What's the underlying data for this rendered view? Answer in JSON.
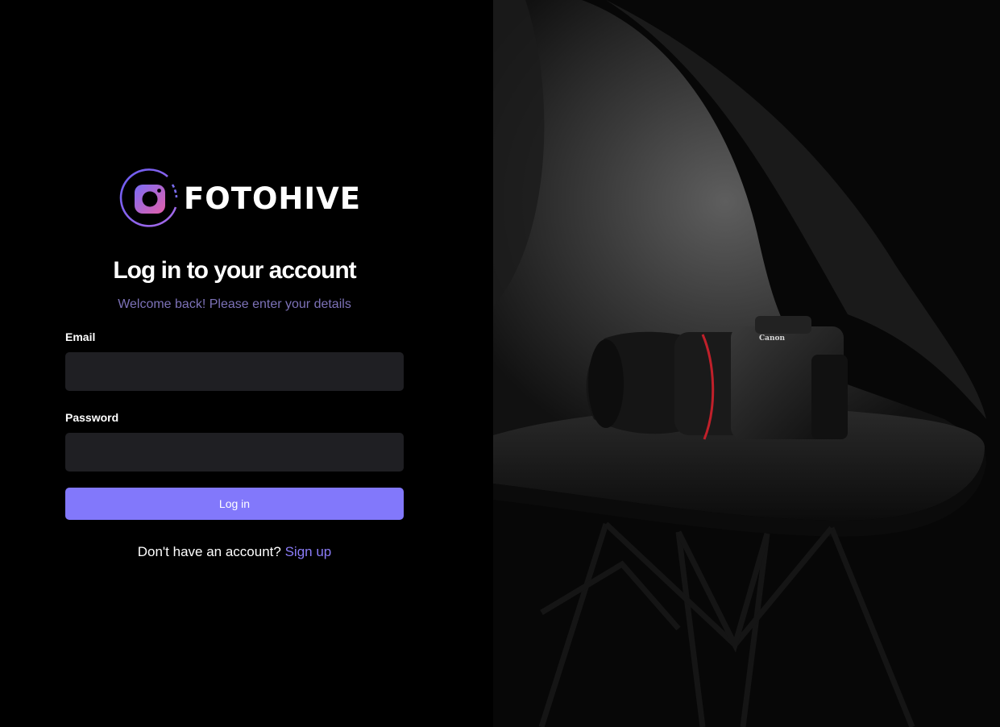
{
  "brand": {
    "name": "FOTOHIVE",
    "logo_icon": "camera-logo-icon",
    "gradient_from": "#7b6cf6",
    "gradient_to": "#e35fa9"
  },
  "login": {
    "title": "Log in to your account",
    "subtitle": "Welcome back! Please enter your details",
    "email_label": "Email",
    "email_value": "",
    "password_label": "Password",
    "password_value": "",
    "submit_label": "Log in",
    "signup_prompt": "Don't have an account?",
    "signup_link": "Sign up"
  },
  "hero": {
    "image_subject": "camera-on-chair-photo"
  },
  "colors": {
    "accent": "#8278fb",
    "link": "#8b7cf8",
    "subtitle": "#7d72b8",
    "input_bg": "#1f1f23",
    "background": "#000000"
  }
}
